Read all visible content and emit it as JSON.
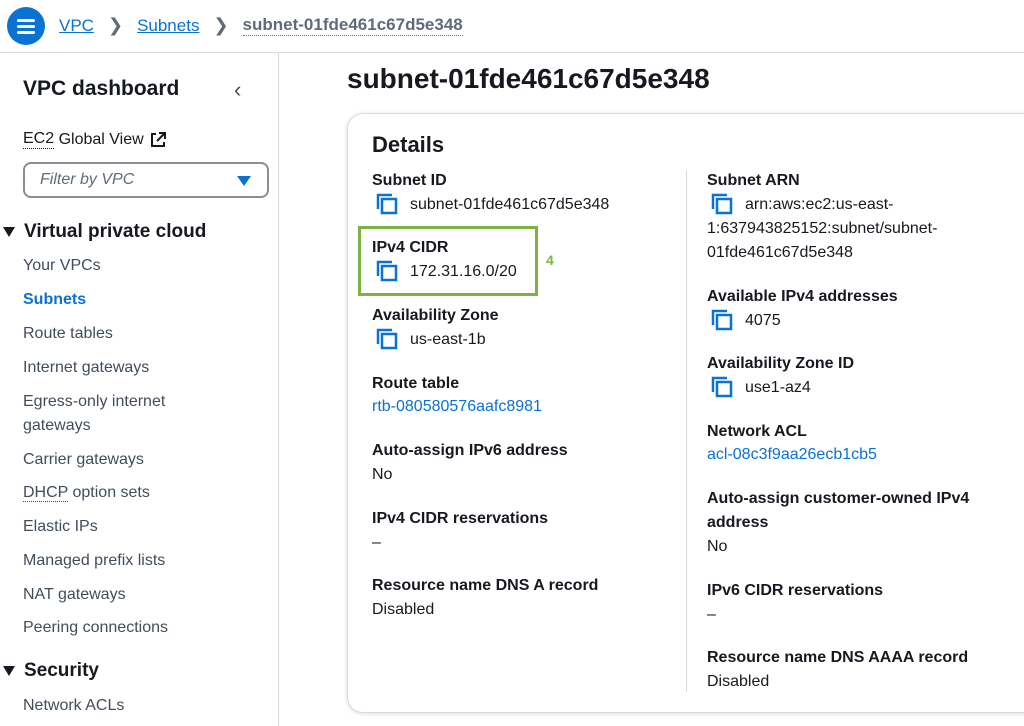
{
  "breadcrumb": {
    "items": [
      "VPC",
      "Subnets"
    ],
    "current": "subnet-01fde461c67d5e348"
  },
  "sidebar": {
    "title": "VPC dashboard",
    "ec2_abbr": "EC2",
    "ec2_text": "Global View",
    "filter_placeholder": "Filter by VPC",
    "section_vpc": "Virtual private cloud",
    "items": [
      "Your VPCs",
      "Subnets",
      "Route tables",
      "Internet gateways",
      "Egress-only internet",
      "gateways",
      "Carrier gateways",
      "DHCP",
      " option sets",
      "Elastic IPs",
      "Managed prefix lists",
      "NAT gateways",
      "Peering connections"
    ],
    "section_security": "Security",
    "security_items": [
      "Network ACLs"
    ]
  },
  "page": {
    "title": "subnet-01fde461c67d5e348"
  },
  "details": {
    "title": "Details",
    "left": {
      "subnet_id_label": "Subnet ID",
      "subnet_id": "subnet-01fde461c67d5e348",
      "ipv4_cidr_label": "IPv4 CIDR",
      "ipv4_cidr": "172.31.16.0/20",
      "az_label": "Availability Zone",
      "az": "us-east-1b",
      "route_table_label": "Route table",
      "route_table": "rtb-080580576aafc8981",
      "auto_ipv6_label": "Auto-assign IPv6 address",
      "auto_ipv6": "No",
      "ipv4_res_label": "IPv4 CIDR reservations",
      "ipv4_res": "–",
      "dns_a_label": "Resource name DNS A record",
      "dns_a": "Disabled"
    },
    "right": {
      "arn_label": "Subnet ARN",
      "arn_line1": "arn:aws:ec2:us-east-",
      "arn_line2": "1:637943825152:subnet/subnet-",
      "arn_line3": "01fde461c67d5e348",
      "avail_ipv4_label": "Available IPv4 addresses",
      "avail_ipv4": "4075",
      "az_id_label": "Availability Zone ID",
      "az_id": "use1-az4",
      "nacl_label": "Network ACL",
      "nacl": "acl-08c3f9aa26ecb1cb5",
      "auto_cust_label_1": "Auto-assign customer-owned IPv4",
      "auto_cust_label_2": "address",
      "auto_cust": "No",
      "ipv6_res_label": "IPv6 CIDR reservations",
      "ipv6_res": "–",
      "dns_aaaa_label": "Resource name DNS AAAA record",
      "dns_aaaa": "Disabled"
    }
  },
  "annotation": {
    "number": "4",
    "color": "#7cb342"
  },
  "colors": {
    "accent": "#0972d3",
    "text": "#16191f",
    "muted": "#414d5c"
  }
}
